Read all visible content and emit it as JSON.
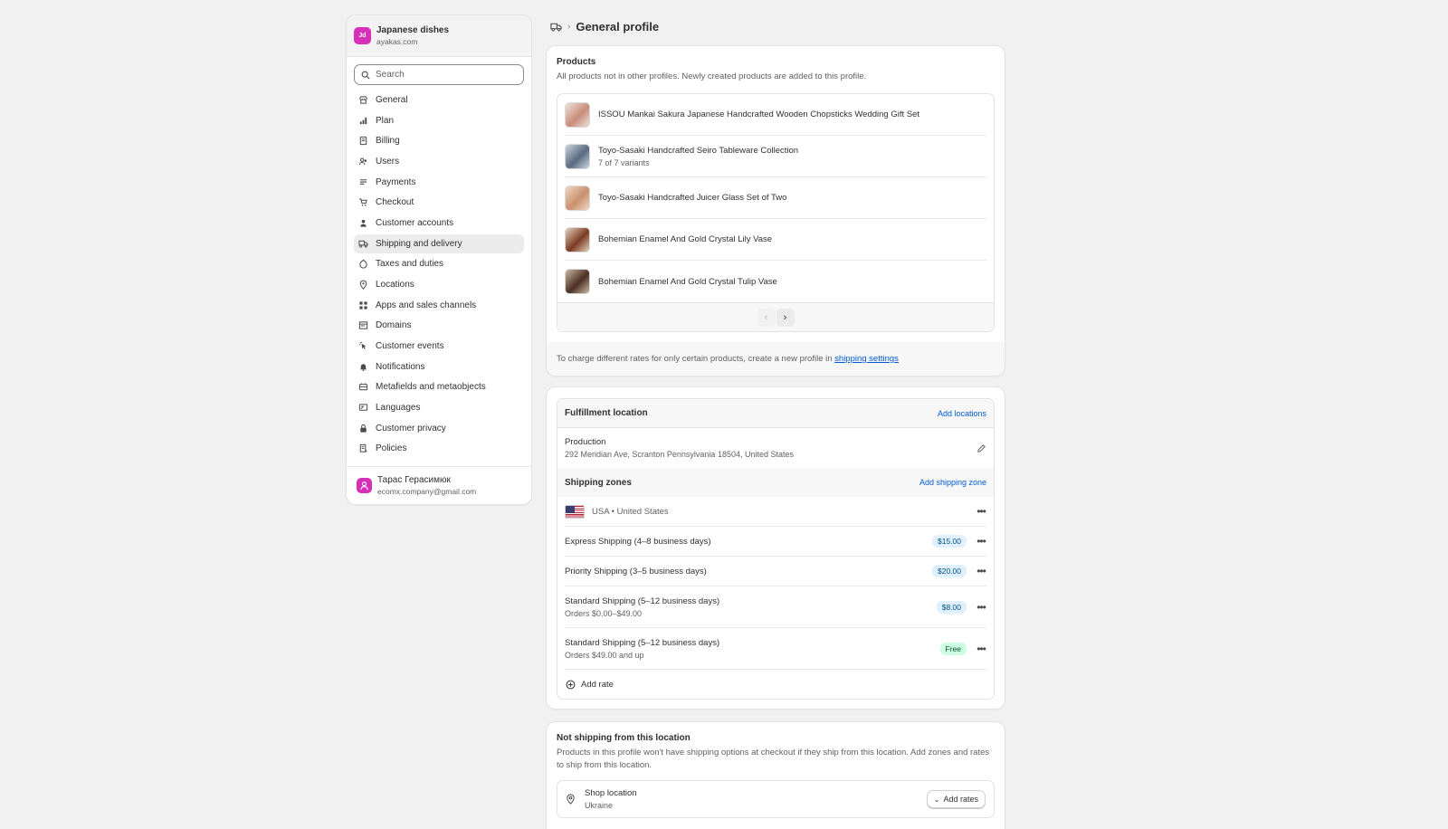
{
  "store": {
    "initials": "Jd",
    "name": "Japanese dishes",
    "domain": "ayakas.com"
  },
  "search": {
    "placeholder": "Search"
  },
  "nav": [
    {
      "label": "General",
      "icon": "store-icon"
    },
    {
      "label": "Plan",
      "icon": "plan-icon"
    },
    {
      "label": "Billing",
      "icon": "billing-icon"
    },
    {
      "label": "Users",
      "icon": "users-icon"
    },
    {
      "label": "Payments",
      "icon": "payments-icon"
    },
    {
      "label": "Checkout",
      "icon": "cart-icon"
    },
    {
      "label": "Customer accounts",
      "icon": "person-icon"
    },
    {
      "label": "Shipping and delivery",
      "icon": "truck-icon",
      "active": true
    },
    {
      "label": "Taxes and duties",
      "icon": "tax-icon"
    },
    {
      "label": "Locations",
      "icon": "location-icon"
    },
    {
      "label": "Apps and sales channels",
      "icon": "apps-icon"
    },
    {
      "label": "Domains",
      "icon": "domains-icon"
    },
    {
      "label": "Customer events",
      "icon": "cursor-icon"
    },
    {
      "label": "Notifications",
      "icon": "bell-icon"
    },
    {
      "label": "Metafields and metaobjects",
      "icon": "metafields-icon"
    },
    {
      "label": "Languages",
      "icon": "language-icon"
    },
    {
      "label": "Customer privacy",
      "icon": "lock-icon"
    },
    {
      "label": "Policies",
      "icon": "policies-icon"
    }
  ],
  "user": {
    "name": "Тарас Герасимюк",
    "email": "ecomx.company@gmail.com"
  },
  "breadcrumb": {
    "icon": "truck-icon",
    "title": "General profile"
  },
  "products_card": {
    "title": "Products",
    "subtitle": "All products not in other profiles. Newly created products are added to this profile.",
    "items": [
      {
        "name": "ISSOU Mankai Sakura Japanese Handcrafted Wooden Chopsticks Wedding Gift Set",
        "variants": ""
      },
      {
        "name": "Toyo-Sasaki Handcrafted Seiro Tableware Collection",
        "variants": "7 of 7 variants"
      },
      {
        "name": "Toyo-Sasaki Handcrafted Juicer Glass Set of Two",
        "variants": ""
      },
      {
        "name": "Bohemian Enamel And Gold Crystal Lily Vase",
        "variants": ""
      },
      {
        "name": "Bohemian Enamel And Gold Crystal Tulip Vase",
        "variants": ""
      }
    ],
    "pager": {
      "prev": "‹",
      "next": "›"
    },
    "footer_text": "To charge different rates for only certain products, create a new profile in",
    "footer_link": "shipping settings"
  },
  "fulfillment": {
    "title": "Fulfillment location",
    "add_locations": "Add locations",
    "location_name": "Production",
    "location_address": "292 Meridian Ave, Scranton Pennsylvania 18504, United States",
    "zones_title": "Shipping zones",
    "add_zone": "Add shipping zone",
    "zone_name": "USA • United States",
    "rates": [
      {
        "name": "Express Shipping (4–8 business days)",
        "condition": "",
        "price": "$15.00"
      },
      {
        "name": "Priority Shipping (3–5 business days)",
        "condition": "",
        "price": "$20.00"
      },
      {
        "name": "Standard Shipping (5–12 business days)",
        "condition": "Orders $0.00–$49.00",
        "price": "$8.00"
      },
      {
        "name": "Standard Shipping (5–12 business days)",
        "condition": "Orders $49.00 and up",
        "price": "Free"
      }
    ],
    "add_rate": "Add rate"
  },
  "not_shipping": {
    "title": "Not shipping from this location",
    "subtitle": "Products in this profile won't have shipping options at checkout if they ship from this location. Add zones and rates to ship from this location.",
    "location_name": "Shop location",
    "location_country": "Ukraine",
    "add_rates": "Add rates"
  },
  "colors": {
    "accent": "#005bd3",
    "avatar": "#d62fb8",
    "price_badge": "#e0f0ff",
    "free_badge": "#cdfee1"
  }
}
